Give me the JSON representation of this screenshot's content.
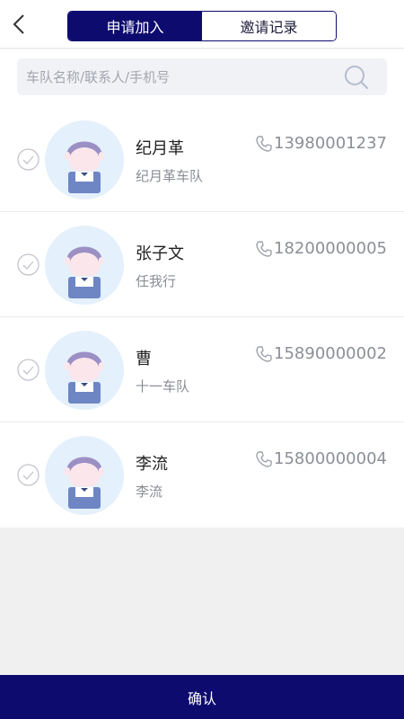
{
  "header": {
    "back_icon": "chevron-left-icon",
    "tabs": [
      {
        "label": "申请加入",
        "active": true
      },
      {
        "label": "邀请记录",
        "active": false
      }
    ]
  },
  "search": {
    "placeholder": "车队名称/联系人/手机号",
    "value": "",
    "icon": "search-icon"
  },
  "members": [
    {
      "name": "纪月革",
      "team": "纪月革车队",
      "phone": "13980001237",
      "checked": false
    },
    {
      "name": "张子文",
      "team": "任我行",
      "phone": "18200000005",
      "checked": false
    },
    {
      "name": "曹",
      "team": "十一车队",
      "phone": "15890000002",
      "checked": false
    },
    {
      "name": "李流",
      "team": "李流",
      "phone": "15800000004",
      "checked": false
    }
  ],
  "footer": {
    "confirm_label": "确认"
  },
  "colors": {
    "primary": "#0d0b6e",
    "avatar_bg": "#e4f0fb",
    "hair": "#9b8fc4",
    "shirt": "#6e86c4"
  }
}
